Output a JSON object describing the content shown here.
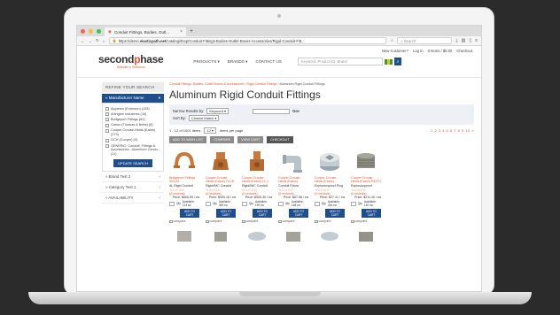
{
  "browser": {
    "tab_title": "Conduit Fittings, Bodies, Outl...",
    "url_prefix": "https://demo.",
    "url_host": "elasticpath.net",
    "url_path": "/catalog/shop/Conduit-Fittings-Bodies-Outlet-Boxes-Accessories/Rigid-Conduit-Fitt...",
    "search_placeholder": "Search"
  },
  "site": {
    "logo_left": "second",
    "logo_o": "p",
    "logo_right": "hase",
    "tagline": "Website in Solutions",
    "toplinks": [
      "New Customer?",
      "Log In",
      "0 Items / $0.00",
      "Checkout"
    ],
    "nav": [
      "PRODUCTS ▾",
      "BRANDS ▾",
      "CONTACT US"
    ],
    "search_placeholder": "Keyword, Product ID, Brand"
  },
  "sidebar": {
    "refine_title": "REFINE YOUR SEARCH",
    "manufacturer_header": "» Manufacturer Name",
    "manufacturers": [
      "Appleton (Emerson) (153)",
      "Arlington Industries (16)",
      "Bridgeport Fittings (81)",
      "Carlon (Thomas & Betts) (5)",
      "Cooper Crouse-Hinds (Eaton) (179)",
      "GCH (Cooper) (0)",
      "GENERIC: Conduit, Fittings & Accessories - Aluminum Condu... (11)"
    ],
    "update_label": "UPDATE SEARCH",
    "facets": [
      "» Brand Test 2",
      "» Category Test 1",
      "» AVAILABILITY"
    ]
  },
  "main": {
    "breadcrumb": [
      "Conduit Fittings, Bodies, Outlet Boxes & Accessories",
      "Rigid Conduit Fittings"
    ],
    "breadcrumb_current": "Aluminum Rigid Conduit Fittings",
    "title": "Aluminum Rigid Conduit Fittings",
    "narrow_label": "Narrow Results by:",
    "narrow_value": "Keyword",
    "go_label": "Go»",
    "sort_label": "Sort By:",
    "sort_value": "Closest Match",
    "count_text": "1 - 12 of 1001 items",
    "per_page": "12",
    "per_page_label": "items per page",
    "pages": "1 2 3 4 5 6 7 8 9 10 »",
    "actions": [
      "ADD TO WISH LIST",
      "COMPARE",
      "VIEW CART",
      "CHECKOUT"
    ]
  },
  "products": [
    {
      "name": "Bridgeport Fittings 904-AL",
      "desc": "AL Rigid Conduit Strap",
      "reviews": "(0 reviews)",
      "price": "Price: $605.59 / ea",
      "avail": "Available: 113 ea",
      "qty_label": "Qty",
      "add": "ADD TO CART",
      "compare": "compare"
    },
    {
      "name": "Cooper Crouse-Hinds (Eaton) OLLE-SC",
      "desc": "Rigid/IMC Conduit",
      "reviews": "(0 reviews)",
      "price": "Price: $905.16 / ea",
      "avail": "Available: 369 ea",
      "qty_label": "Qty",
      "add": "ADD TO CART",
      "compare": "compare"
    },
    {
      "name": "Cooper Crouse-Hinds (Eaton) LL-1 SC",
      "desc": "Rigid/IMC Conduit",
      "reviews": "(0 reviews)",
      "price": "Price: $905.35 / ea",
      "avail": "Available: 199 ea",
      "qty_label": "Qty",
      "add": "ADD TO CART",
      "compare": "compare"
    },
    {
      "name": "Cooper Crouse-Hinds (Eaton) LB155-SA",
      "desc": "Conduit Elbow",
      "reviews": "(0 reviews)",
      "price": "Price: $67.98 / ea",
      "avail": "Available: 148 ea",
      "qty_label": "Qty",
      "add": "ADD TO CART",
      "compare": "compare"
    },
    {
      "name": "Cooper Crouse-Hinds (Eaton) PLG80-SA",
      "desc": "Explosionproof Plug",
      "reviews": "(0 reviews)",
      "price": "Price: $27.41 / ea",
      "avail": "Available: 416 ea",
      "qty_label": "Qty",
      "add": "ADD TO CART",
      "compare": "compare"
    },
    {
      "name": "Cooper Crouse-Hinds (Eaton) RE271 SA",
      "desc": "Explosionproof Reducer",
      "reviews": "(0 reviews)",
      "price": "Price: $211.40 / ea",
      "avail": "Available: 140 ea",
      "qty_label": "Qty",
      "add": "ADD TO CART",
      "compare": "compare"
    }
  ],
  "colors": {
    "accent": "#e8532a",
    "primary": "#1f4e8c"
  }
}
